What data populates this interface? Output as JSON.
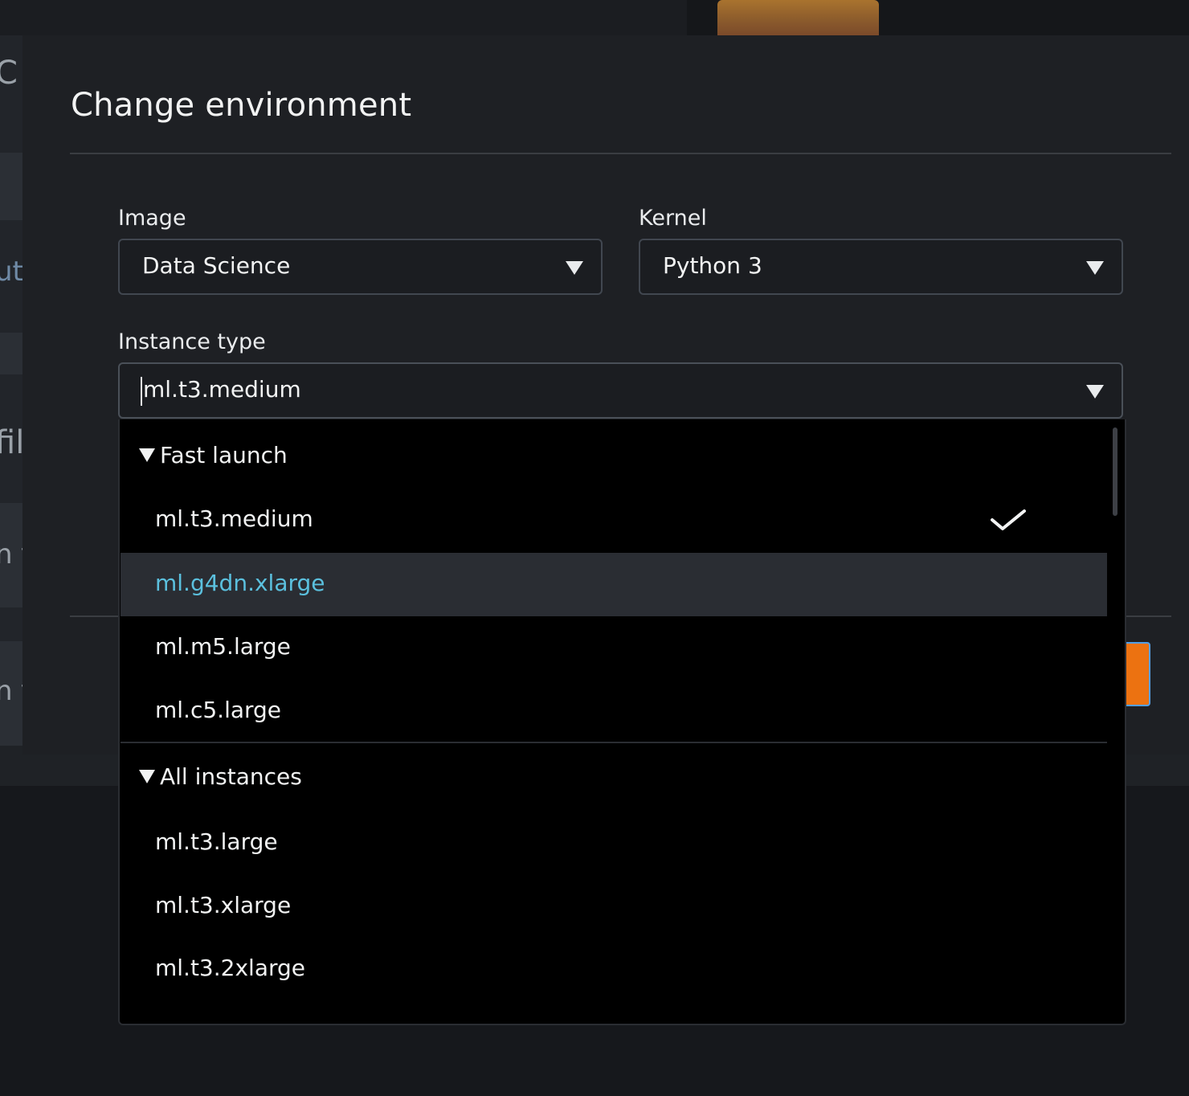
{
  "modal": {
    "title": "Change environment"
  },
  "image_field": {
    "label": "Image",
    "value": "Data Science"
  },
  "kernel_field": {
    "label": "Kernel",
    "value": "Python 3"
  },
  "instance_field": {
    "label": "Instance type",
    "value": "ml.t3.medium"
  },
  "dropdown": {
    "groups": [
      {
        "label": "Fast launch",
        "options": [
          {
            "label": "ml.t3.medium",
            "selected": true
          },
          {
            "label": "ml.g4dn.xlarge",
            "highlighted": true
          },
          {
            "label": "ml.m5.large"
          },
          {
            "label": "ml.c5.large"
          }
        ]
      },
      {
        "label": "All instances",
        "options": [
          {
            "label": "ml.t3.large"
          },
          {
            "label": "ml.t3.xlarge"
          },
          {
            "label": "ml.t3.2xlarge"
          }
        ]
      }
    ],
    "check_icon": "check-icon",
    "highlight_color": "#5bc0de"
  },
  "background": {
    "fragments": [
      "C",
      "ut",
      "fil",
      "n f",
      "n f"
    ]
  },
  "colors": {
    "accent_button": "#ec7211",
    "focus_border": "#539fe5"
  }
}
